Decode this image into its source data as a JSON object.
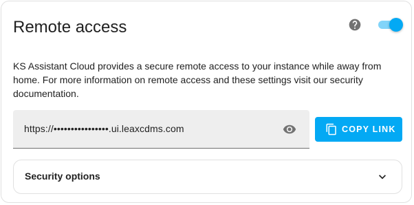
{
  "card": {
    "title": "Remote access",
    "help_icon": "help-circle-icon",
    "toggle": {
      "enabled": true,
      "accent_color": "#03a9f4"
    },
    "description": "KS Assistant Cloud provides a secure remote access to your instance while away from home. For more information on remote access and these settings visit our security documentation.",
    "url_field": {
      "value": "https://••••••••••••••••.ui.leaxcdms.com",
      "reveal_icon": "eye-icon"
    },
    "copy_button": {
      "label": "COPY LINK",
      "icon": "copy-icon"
    },
    "security_options": {
      "label": "Security options",
      "icon": "chevron-down-icon"
    }
  }
}
